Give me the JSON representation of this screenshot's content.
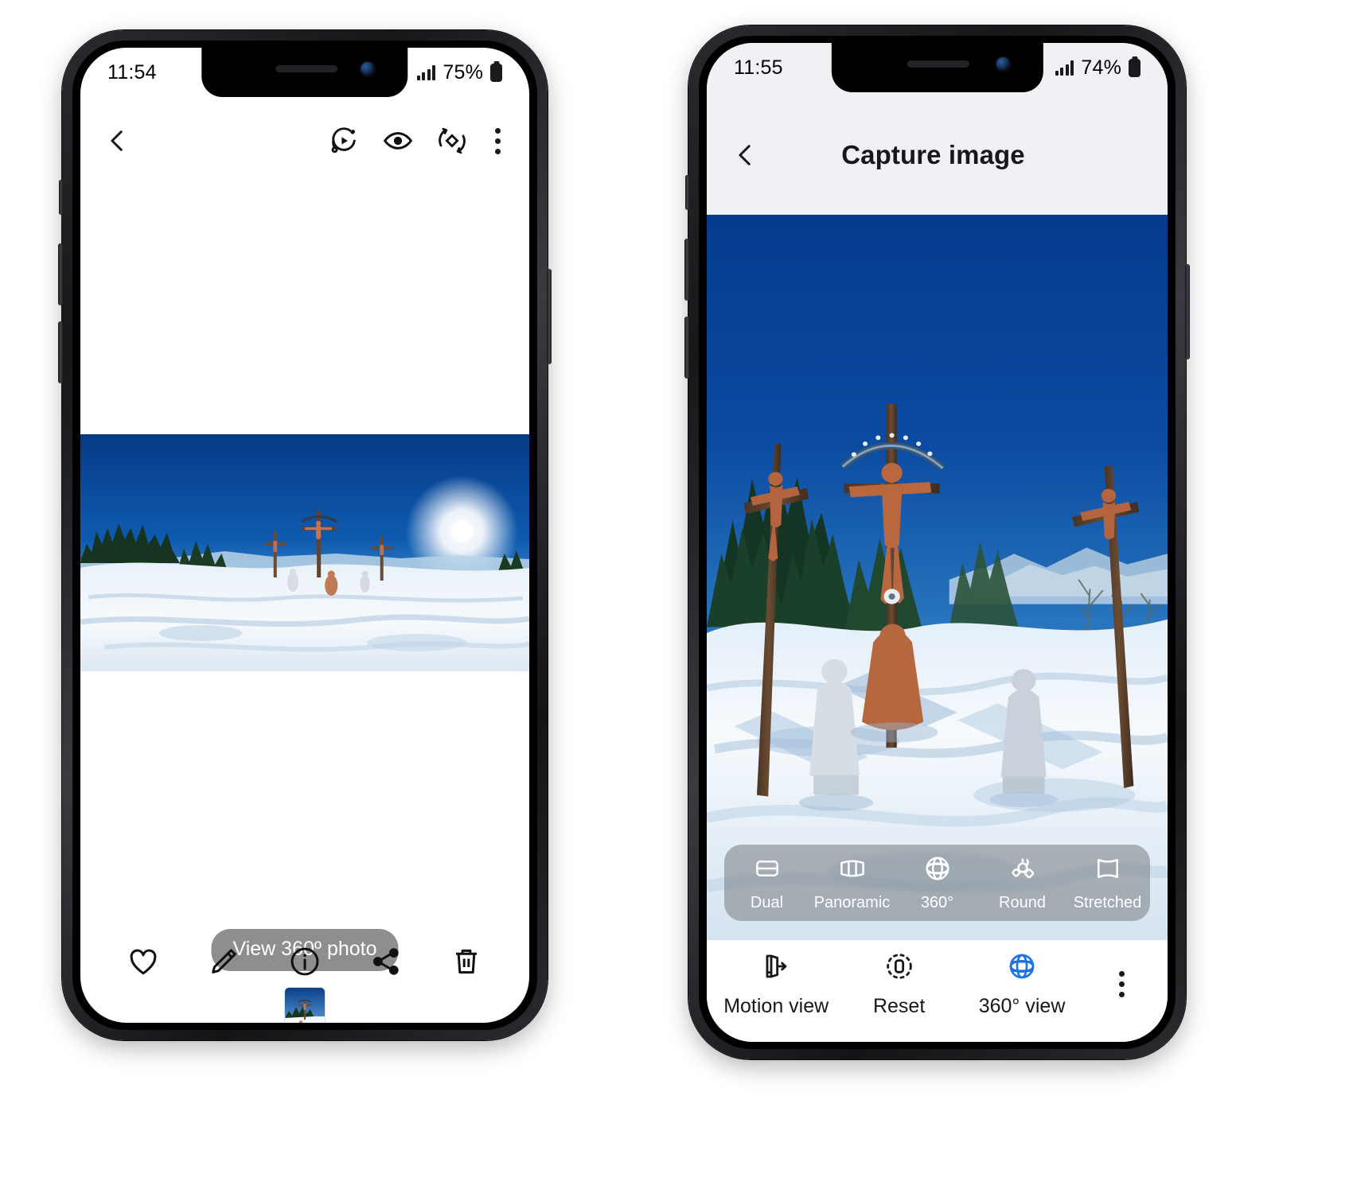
{
  "left_phone": {
    "status_bar": {
      "time": "11:54",
      "battery_text": "75%",
      "signal_icon": "signal-bars-icon",
      "battery_icon": "battery-icon"
    },
    "top_bar": {
      "back_icon": "chevron-left-icon",
      "actions": [
        {
          "name": "motion-photo-icon",
          "label": "Motion photo"
        },
        {
          "name": "eye-view-icon",
          "label": "View"
        },
        {
          "name": "rotate-360-icon",
          "label": "Rotate"
        },
        {
          "name": "more-options-icon",
          "label": "More options"
        }
      ]
    },
    "viewer": {
      "photo_alt": "360 panoramic photo of snowy hilltop with crucifix statues"
    },
    "pill_label": "View 360º photo",
    "thumbnail_alt": "360 photo thumbnail",
    "bottom_bar": [
      {
        "name": "favorite-icon",
        "label": "Favorite"
      },
      {
        "name": "edit-pencil-icon",
        "label": "Edit"
      },
      {
        "name": "info-icon",
        "label": "Details"
      },
      {
        "name": "share-icon",
        "label": "Share"
      },
      {
        "name": "delete-trash-icon",
        "label": "Delete"
      }
    ]
  },
  "right_phone": {
    "status_bar": {
      "time": "11:55",
      "battery_text": "74%",
      "signal_icon": "signal-bars-icon",
      "battery_icon": "battery-icon"
    },
    "header": {
      "back_icon": "chevron-left-icon",
      "title": "Capture image"
    },
    "photo_alt": "360 view of snowy hilltop with wooden crucifixes and statues",
    "mode_bar": [
      {
        "label": "Dual",
        "icon": "dual-split-icon",
        "selected": false
      },
      {
        "label": "Panoramic",
        "icon": "panoramic-icon",
        "selected": false
      },
      {
        "label": "360°",
        "icon": "globe-grid-icon",
        "selected": false
      },
      {
        "label": "Round",
        "icon": "round-sphere-icon",
        "selected": false
      },
      {
        "label": "Stretched",
        "icon": "stretched-frame-icon",
        "selected": false
      }
    ],
    "bottom_bar": [
      {
        "label": "Motion view",
        "icon": "motion-view-icon",
        "active": false
      },
      {
        "label": "Reset",
        "icon": "reset-icon",
        "active": false
      },
      {
        "label": "360° view",
        "icon": "globe-grid-blue-icon",
        "active": true
      },
      {
        "label": "",
        "icon": "more-options-icon",
        "active": false
      }
    ]
  },
  "colors": {
    "accent_blue": "#1a73e8",
    "pill_gray": "#8e8e8e",
    "header_gray": "#f0f1f4",
    "text_dark": "#17181b",
    "sky_top": "#0a3f8f",
    "sky_low": "#8fc4ee"
  }
}
